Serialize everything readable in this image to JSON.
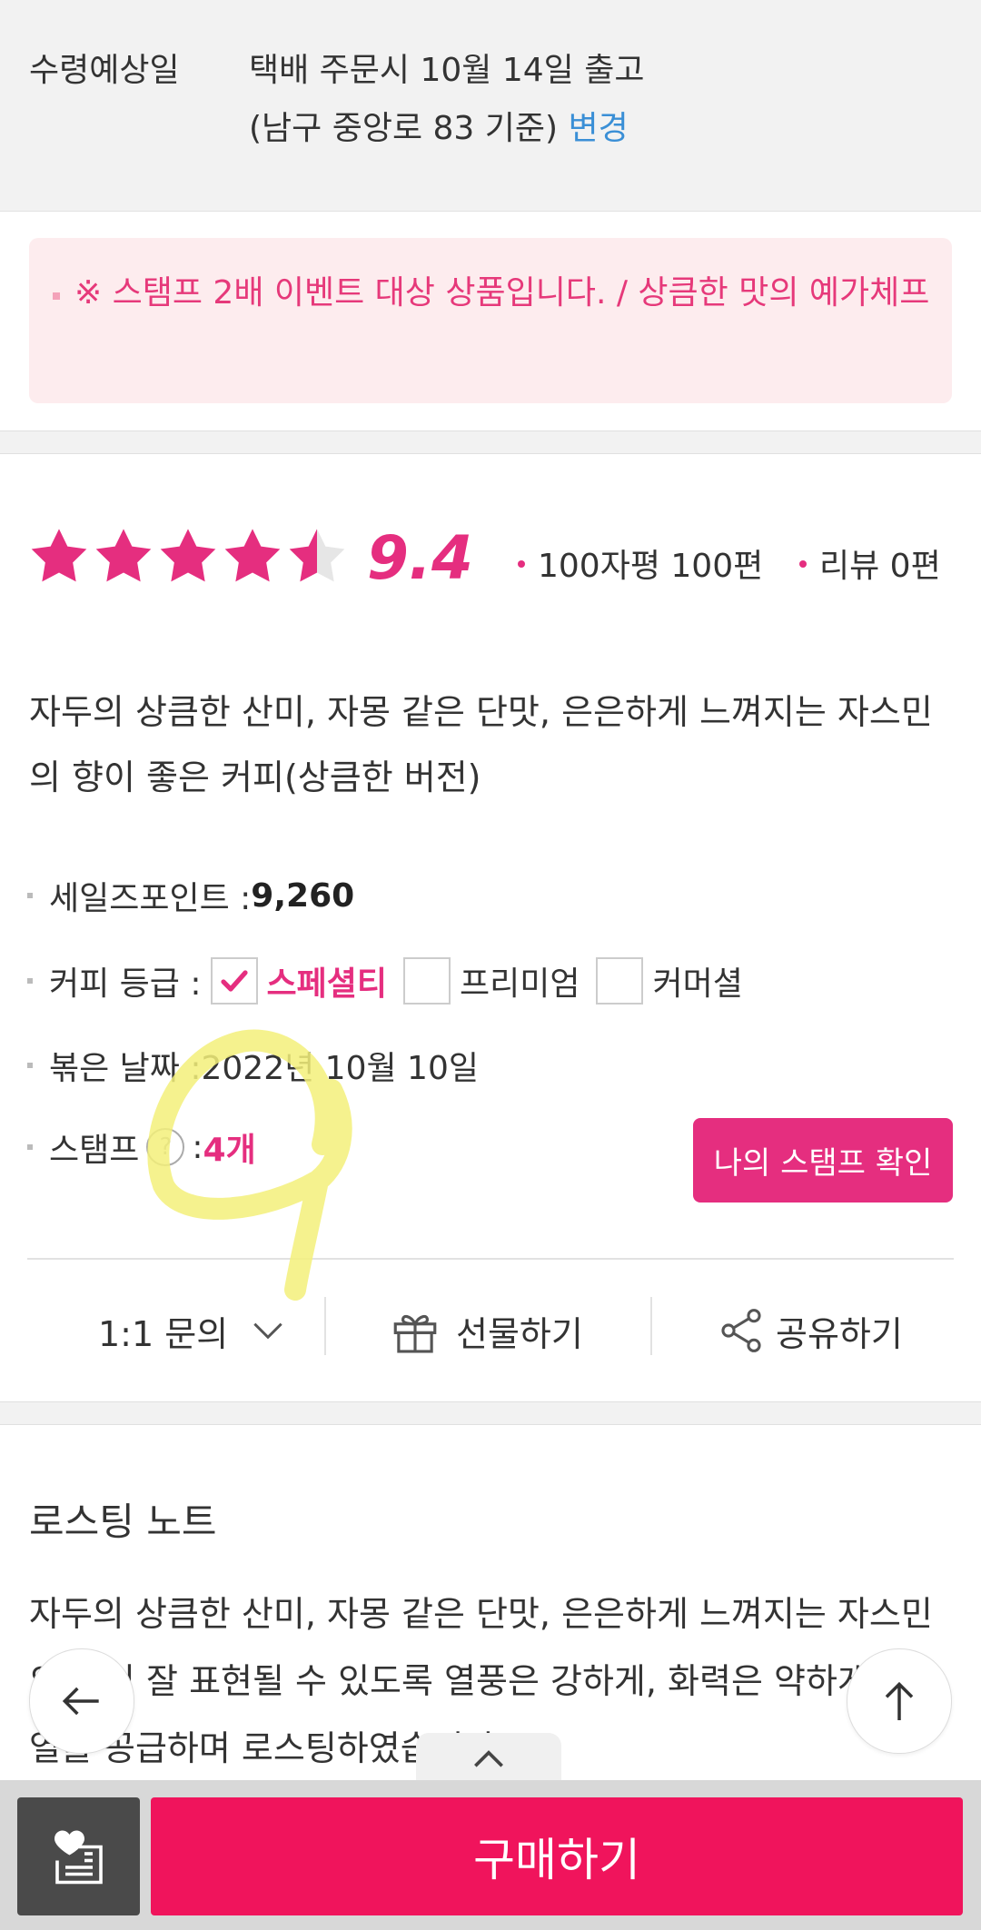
{
  "delivery": {
    "label": "수령예상일",
    "line1": "택배 주문시 10월 14일 출고",
    "line2_prefix": "(남구 중앙로 83 기준)",
    "change_label": "변경"
  },
  "event": {
    "text": "※ 스탬프 2배 이벤트 대상 상품입니다. / 상큼한 맛의 예가체프"
  },
  "rating": {
    "score": "9.4",
    "stars_filled": 4.5,
    "stars_max": 5,
    "short_reviews": "100자평 100편",
    "reviews": "리뷰 0편"
  },
  "description": "자두의 상큼한 산미, 자몽 같은 단맛, 은은하게 느껴지는 자스민의 향이 좋은 커피(상큼한 버전)",
  "info": {
    "points_label": "세일즈포인트 : ",
    "points_value": "9,260",
    "grade_label": "커피 등급 : ",
    "grade_options": [
      "스페셜티",
      "프리미엄",
      "커머셜"
    ],
    "roast_label": "볶은 날짜 : ",
    "roast_value": "2022년 10월 10일",
    "stamp_label": "스탬프",
    "stamp_sep": " : ",
    "stamp_value": "4개",
    "stamp_button": "나의 스탬프 확인"
  },
  "actions": {
    "inquiry": "1:1 문의",
    "gift": "선물하기",
    "share": "공유하기"
  },
  "roasting": {
    "title": "로스팅 노트",
    "text": "자두의 상큼한 산미, 자몽 같은 단맛, 은은하게 느껴지는 자스민의 향이 잘 표현될 수 있도록 열풍은 강하게, 화력은 약하게 으로 열을 공급하며 로스팅하였습니다."
  },
  "bottom": {
    "buy": "구매하기"
  },
  "colors": {
    "accent": "#e52e7f",
    "buy": "#f0145c",
    "link": "#3a8fd6",
    "highlight": "#f3f07a"
  }
}
